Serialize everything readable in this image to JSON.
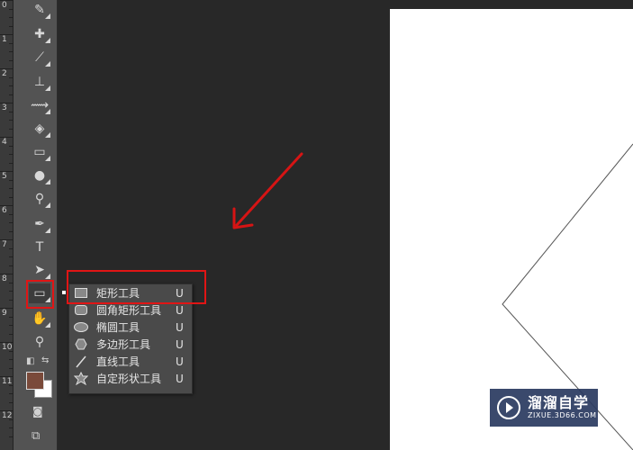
{
  "ruler": {
    "labels": [
      "0",
      "1",
      "2",
      "3",
      "4",
      "5",
      "6",
      "7",
      "8",
      "9",
      "10",
      "11",
      "12"
    ]
  },
  "tools": [
    {
      "name": "eyedropper-icon",
      "glyph": "✎"
    },
    {
      "name": "healing-brush-icon",
      "glyph": "✚"
    },
    {
      "name": "brush-icon",
      "glyph": "⟋"
    },
    {
      "name": "clone-stamp-icon",
      "glyph": "⊥"
    },
    {
      "name": "history-brush-icon",
      "glyph": "⟿"
    },
    {
      "name": "eraser-icon",
      "glyph": "◈"
    },
    {
      "name": "gradient-icon",
      "glyph": "▭"
    },
    {
      "name": "blur-icon",
      "glyph": "●"
    },
    {
      "name": "dodge-icon",
      "glyph": "⚲"
    },
    {
      "name": "pen-icon",
      "glyph": "✒"
    },
    {
      "name": "type-icon",
      "glyph": "T"
    },
    {
      "name": "path-selection-icon",
      "glyph": "➤"
    },
    {
      "name": "rectangle-tool-icon",
      "glyph": "▭"
    },
    {
      "name": "hand-icon",
      "glyph": "✋"
    },
    {
      "name": "zoom-icon",
      "glyph": "⚲"
    }
  ],
  "colors": {
    "foreground": "#7a4a3a",
    "background": "#ffffff",
    "annotation": "#e01515"
  },
  "flyout": {
    "items": [
      {
        "label": "矩形工具",
        "key": "U",
        "icon": "rectangle-icon"
      },
      {
        "label": "圆角矩形工具",
        "key": "U",
        "icon": "rounded-rectangle-icon"
      },
      {
        "label": "椭圆工具",
        "key": "U",
        "icon": "ellipse-icon"
      },
      {
        "label": "多边形工具",
        "key": "U",
        "icon": "polygon-icon"
      },
      {
        "label": "直线工具",
        "key": "U",
        "icon": "line-icon"
      },
      {
        "label": "自定形状工具",
        "key": "U",
        "icon": "custom-shape-icon"
      }
    ]
  },
  "watermark": {
    "title": "溜溜自学",
    "url": "ZIXUE.3D66.COM"
  }
}
